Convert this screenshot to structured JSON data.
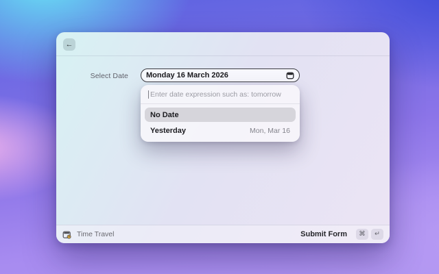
{
  "window": {
    "header": {
      "back_button_glyph": "←"
    },
    "form": {
      "label": "Select Date",
      "date_field": {
        "value": "Monday 16 March 2026",
        "icon": "calendar-icon"
      }
    },
    "dropdown": {
      "input": {
        "placeholder": "Enter date expression such as: tomorrow",
        "value": ""
      },
      "options": [
        {
          "label": "No Date",
          "detail": "",
          "selected": true
        },
        {
          "label": "Yesterday",
          "detail": "Mon, Mar 16",
          "selected": false
        }
      ]
    },
    "footer": {
      "app": {
        "icon": "calendar-clock-icon",
        "name": "Time Travel"
      },
      "submit": {
        "label": "Submit Form",
        "keys": [
          "⌘",
          "↵"
        ]
      }
    }
  },
  "colors": {
    "backdrop_cyan": "#6ae7f6",
    "backdrop_indigo": "#3f4cd9",
    "backdrop_pink": "#eeb2ec",
    "backdrop_purple": "#a78bf0",
    "window_gradient_start": "#d7f2f3",
    "window_gradient_end": "#ece4f4",
    "field_border": "#3a3a40",
    "selection_gray": "#d6d5db"
  }
}
